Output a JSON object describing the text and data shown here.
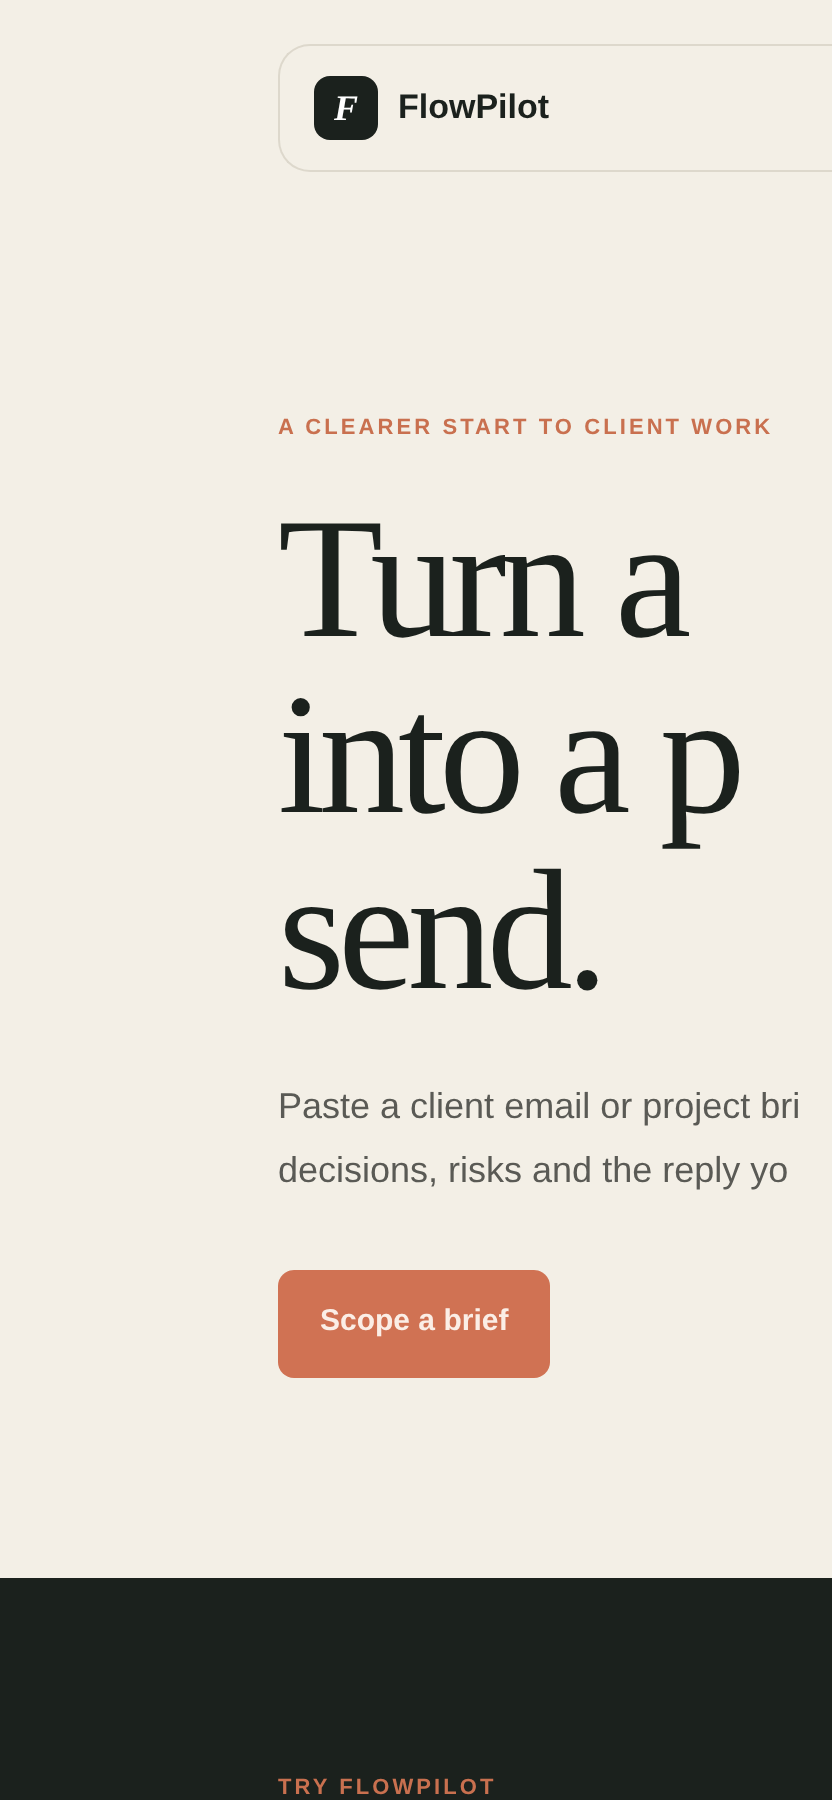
{
  "header": {
    "logo_letter": "F",
    "brand": "FlowPilot"
  },
  "hero": {
    "eyebrow": "A CLEARER START TO CLIENT WORK",
    "heading_lines": [
      "Turn a",
      "into a p",
      "send."
    ],
    "paragraph_lines": [
      "Paste a client email or project bri",
      "decisions, risks and the reply yo"
    ],
    "button": "Scope a brief"
  },
  "next_section": {
    "eyebrow": "TRY FLOWPILOT"
  }
}
